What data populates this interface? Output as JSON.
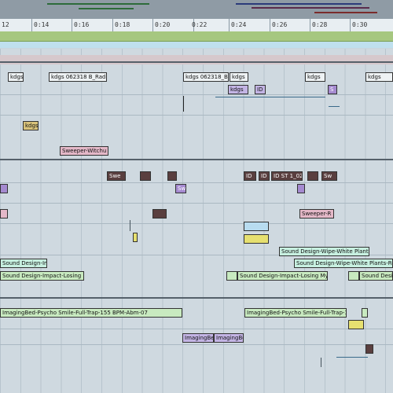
{
  "ruler": {
    "ticks": [
      "12",
      "0:14",
      "0:16",
      "0:18",
      "0:20",
      "0:22",
      "0:24",
      "0:26",
      "0:28",
      "0:30"
    ]
  },
  "clips": {
    "kdgs_a": "kdgs",
    "kdgs_b": "kdgs 062318 B_Radio dc",
    "kdgs_c": "kdgs 062318_B",
    "kdgs_d": "kdgs",
    "kdgs_e": "kdgs",
    "kdgs_f": "kdgs",
    "kdgs_g": "kdgs",
    "kdgs_h": "kdgs",
    "id_a": "ID",
    "s_a": "S",
    "kdgs_i": "kdgs",
    "sweeper_a": "Sweeper-Witchu",
    "swe": "Swe",
    "sw": "Sw",
    "id_b": "ID",
    "id_c": "ID",
    "id_d": "ID ST 1_02",
    "sw_b": "Sw",
    "sweeper_b": "Sweeper-R",
    "sd_wipe1": "Sound Design-Wipe-White Plants-02",
    "sd_impact1": "Sound Design-Impact-I",
    "sd_wipe2": "Sound Design-Wipe-White Plants-Rev",
    "sd_impact2": "Sound Design-Impact-Losing My I",
    "sd_impact3": "Sound Design-Impact-Losing My I",
    "sd_c": "Sound Desig",
    "img1": "ImagingBed-Psycho Smile-Full-Trap-155 BPM-Abm-07",
    "img2": "ImagingBed-Psycho Smile-Full-Trap-15",
    "img3": "ImagingBe",
    "img4": "ImagingBe"
  }
}
